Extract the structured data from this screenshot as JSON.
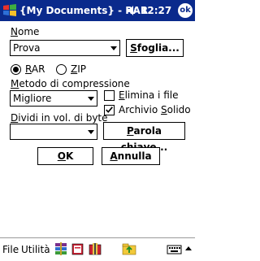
{
  "titlebar": {
    "title": "{My Documents} - RAR",
    "time": "12:27",
    "ok_label": "ok"
  },
  "form": {
    "nome_label": "Nome",
    "nome_value": "Prova",
    "sfoglia_label": "Sfoglia...",
    "radio_rar_label": "RAR",
    "radio_zip_label": "ZIP",
    "radio_rar_selected": true,
    "metodo_label": "Metodo di compressione",
    "metodo_value": "Migliore",
    "elimina_label": "Elimina i file",
    "elimina_checked": false,
    "archivio_solido_label": "Archivio Solido",
    "archivio_solido_checked": true,
    "dividi_label": "Dividi in vol. di byte",
    "dividi_value": "",
    "parola_label": "Parola chiave...",
    "ok_label": "OK",
    "annulla_label": "Annulla"
  },
  "taskbar": {
    "file_label": "File",
    "utilita_label": "Utilità"
  }
}
